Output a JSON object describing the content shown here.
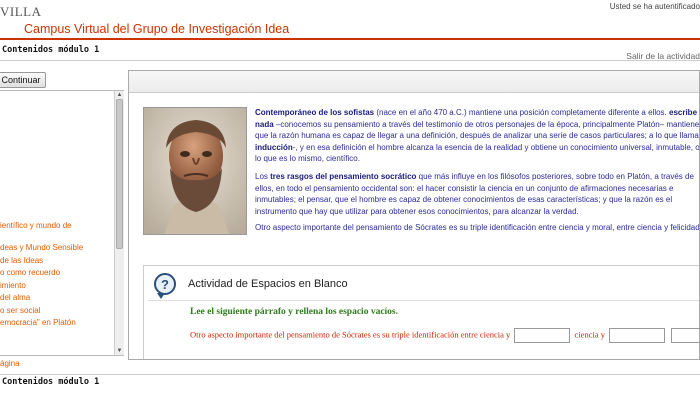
{
  "header": {
    "brand": "VILLA",
    "site_title": "Campus Virtual del Grupo de Investigación Idea",
    "auth_text": "Usted se ha autentificado"
  },
  "module": {
    "title": "Contenidos módulo 1",
    "exit_link": "Salir de la actividad"
  },
  "left": {
    "continue_label": "Continuar",
    "toc": [
      "ientífico y mundo de",
      "deas y Mundo Sensible",
      "de las Ideas",
      "o como recuerdo",
      "imiento",
      "del alma",
      "o ser social",
      "emocracia\" en Platón"
    ],
    "page_link": "ágina"
  },
  "content": {
    "p1_bold1": "Contemporáneo de los sofistas",
    "p1_a": " (nace en el año 470 a.C.) mantiene una posición completamente diferente a ellos. ",
    "p1_bold2": "escribe nada",
    "p1_b": " –conocemos su pensamiento a través del testimonio de otros personajes de la época, principalmente Platón– mantiene que la razón humana es capaz de llegar a una definición, después de analizar una serie de casos particulares; a lo que llama ",
    "p1_bold3": "inducción",
    "p1_c": "-, y en esa definición el hombre alcanza la esencia de la realidad y obtiene un conocimiento universal, inmutable, o lo que es lo mismo, científico.",
    "p2_a": "Los ",
    "p2_bold": "tres rasgos del pensamiento socrático",
    "p2_b": " que más influye en los filósofos posteriores, sobre todo en Platón, a través de ellos, en todo el pensamiento occidental son: el hacer consistir la ciencia en un conjunto de afirmaciones necesarias e inmutables; el pensar, que el hombre es capaz de obtener conocimientos de esas características; y que la razón es el instrumento que hay que utilizar para obtener esos conocimientos, para alcanzar la verdad.",
    "p3": "Otro aspecto importante del pensamiento de Sócrates es su triple identificación entre ciencia y moral, entre ciencia y felicidad."
  },
  "activity": {
    "icon_glyph": "?",
    "title": "Actividad de Espacios en Blanco",
    "instruction": "Lee el siguiente párrafo y rellena los espacio vacíos.",
    "sentence_a": "Otro aspecto importante del pensamiento de Sócrates es su triple identificación entre ciencia y",
    "sentence_b": "ciencia y",
    "blank1_value": "",
    "blank2_value": "",
    "blank3_value": ""
  },
  "footer": {
    "title": "Contenidos módulo 1"
  },
  "colors": {
    "accent": "#cc3300",
    "link": "#e65c00",
    "body_text": "#2b2b9a",
    "instruction": "#2e7d1a"
  }
}
